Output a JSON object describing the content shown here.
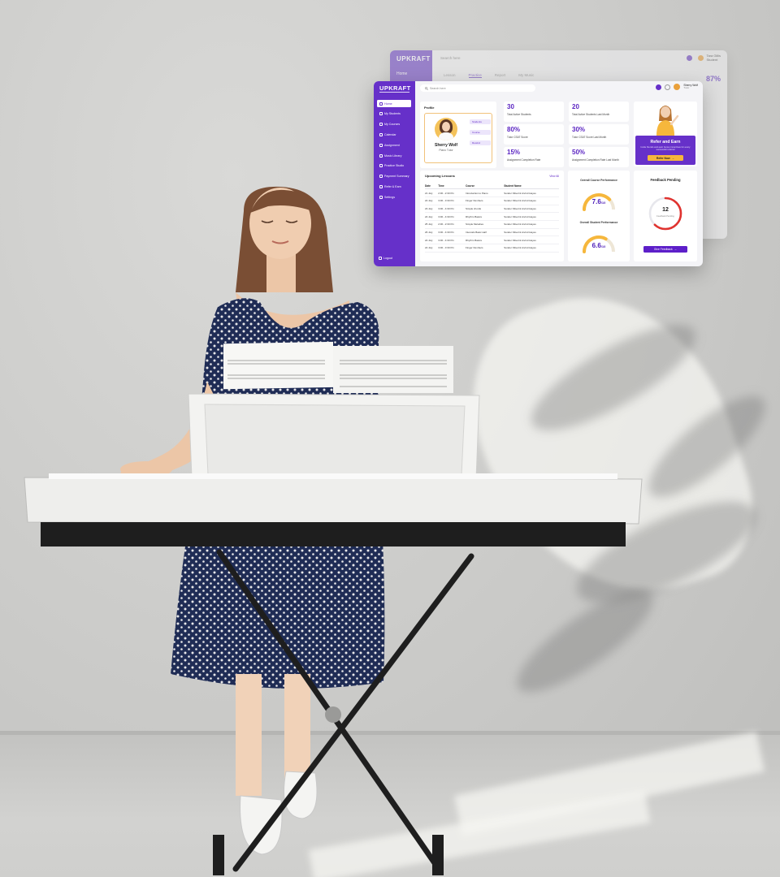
{
  "back_dashboard": {
    "logo": "UPKRAFT",
    "sidebar_item": "Home",
    "search_placeholder": "Search here",
    "tabs": [
      "Lesson",
      "Practice",
      "Report",
      "My Music"
    ],
    "active_tab": 1,
    "percent": "87%",
    "user_name": "Tara Gillis",
    "user_role": "Student"
  },
  "dashboard": {
    "logo": "UPKRAFT",
    "search_placeholder": "Search here",
    "user": {
      "name": "Sherry Wolf",
      "role": "Tutor"
    },
    "sidebar": {
      "items": [
        {
          "label": "Home",
          "icon": "home-icon",
          "active": true
        },
        {
          "label": "My Students",
          "icon": "users-icon",
          "active": false
        },
        {
          "label": "My Courses",
          "icon": "book-icon",
          "active": false
        },
        {
          "label": "Calendar",
          "icon": "calendar-icon",
          "active": false
        },
        {
          "label": "Assignment",
          "icon": "clipboard-icon",
          "active": false
        },
        {
          "label": "Music Library",
          "icon": "music-icon",
          "active": false
        },
        {
          "label": "Practice Studio",
          "icon": "studio-icon",
          "active": false
        },
        {
          "label": "Payment Summary",
          "icon": "wallet-icon",
          "active": false
        },
        {
          "label": "Refer & Earn",
          "icon": "gift-icon",
          "active": false
        },
        {
          "label": "Settings",
          "icon": "gear-icon",
          "active": false
        }
      ],
      "logout": "Logout"
    },
    "profile": {
      "title": "Profile",
      "name": "Sherry Wolf",
      "role": "Piano Tutor",
      "pills": [
        "Students",
        "Course",
        "Rewind"
      ]
    },
    "stats": [
      {
        "value": "30",
        "label": "Total Active Students"
      },
      {
        "value": "20",
        "label": "Total Active Students Last Month"
      },
      {
        "value": "80%",
        "label": "Tutor CSAT Score"
      },
      {
        "value": "30%",
        "label": "Tutor CSAT Score Last Month"
      },
      {
        "value": "15%",
        "label": "Assignment Completion Rate"
      },
      {
        "value": "50%",
        "label": "Assignment Completion Rate Last Month"
      }
    ],
    "refer": {
      "title": "Refer and Earn",
      "subtitle": "Invite friends and earn bonus incentives for every successful referral",
      "button": "Refer Now"
    },
    "lessons": {
      "title": "Upcoming Lessons",
      "view_all": "View All",
      "columns": [
        "Date",
        "Time",
        "Course",
        "Student Name"
      ],
      "rows": [
        [
          "21 July",
          "2:00 - 2:30 Pm",
          "Introduction to Piano",
          "Sunder Kibed & Arvind Hayes"
        ],
        [
          "22 July",
          "3:00 - 3:30 Pm",
          "Finger Numbers",
          "Sunder Kibed & Arvind Hayes"
        ],
        [
          "23 July",
          "3:00 - 4:30 Pm",
          "Simple chords",
          "Sunder Kibed & Arvind Hayes"
        ],
        [
          "24 July",
          "3:00 - 4:30 Pm",
          "Rhythm Basics",
          "Sunder Kibed & Arvind Hayes"
        ],
        [
          "25 July",
          "2:00 - 2:30 Pm",
          "Simple Melodies",
          "Sunder Kibed & Arvind Hayes"
        ],
        [
          "26 July",
          "3:00 - 4:30 Pm",
          "Intervals Basic Half",
          "Sunder Kibed & Arvind Hayes"
        ],
        [
          "24 July",
          "3:00 - 4:30 Pm",
          "Rhythm Basics",
          "Sunder Kibed & Arvind Hayes"
        ],
        [
          "22 July",
          "3:00 - 3:30 Pm",
          "Finger Numbers",
          "Sunder Kibed & Arvind Hayes"
        ]
      ]
    },
    "performance": [
      {
        "title": "Overall Course Performance",
        "value": "7.6",
        "suffix": "/10",
        "score": 7.6
      },
      {
        "title": "Overall Student Performance",
        "value": "6.6",
        "suffix": "/10",
        "score": 6.6
      }
    ],
    "feedback": {
      "title": "Feedback Pending",
      "count": "12",
      "count_label": "Feedback Pending",
      "fraction": 0.62,
      "button": "Give Feedback"
    },
    "colors": {
      "sidebar": "#6630c9",
      "accent": "#5b25c2",
      "gauge": "#f6b73c",
      "ring": "#e0332f",
      "refer_button": "#f6b73c"
    }
  }
}
